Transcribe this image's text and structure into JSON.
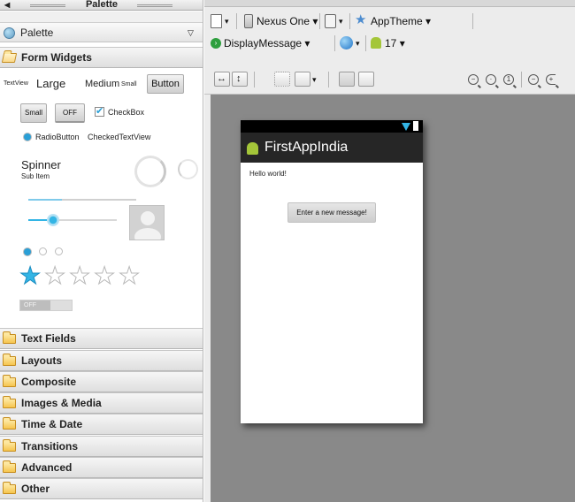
{
  "palette": {
    "window_title": "Palette",
    "header_label": "Palette",
    "form_widgets_label": "Form Widgets",
    "widgets": {
      "textview": "TextView",
      "large": "Large",
      "medium": "Medium",
      "small": "Small",
      "button": "Button",
      "small_button": "Small",
      "toggle_off": "OFF",
      "checkbox": "CheckBox",
      "radiobutton": "RadioButton",
      "checked_textview": "CheckedTextView",
      "spinner": "Spinner",
      "spinner_sub": "Sub Item",
      "switch_off": "OFF"
    },
    "rating_filled": 1,
    "rating_total": 5,
    "categories": [
      {
        "label": "Text Fields"
      },
      {
        "label": "Layouts"
      },
      {
        "label": "Composite"
      },
      {
        "label": "Images & Media"
      },
      {
        "label": "Time & Date"
      },
      {
        "label": "Transitions"
      },
      {
        "label": "Advanced"
      },
      {
        "label": "Other"
      }
    ]
  },
  "toolbar": {
    "device": "Nexus One",
    "theme": "AppTheme",
    "activity": "DisplayMessage",
    "api_level": "17"
  },
  "device_preview": {
    "app_title": "FirstAppIndia",
    "hello_text": "Hello world!",
    "button_label": "Enter a new message!",
    "action_bar_color": "#262626",
    "status_bar_color": "#000000"
  },
  "colors": {
    "accent_blue": "#33b5e5",
    "android_green": "#a4c639",
    "canvas_gray": "#898989"
  }
}
